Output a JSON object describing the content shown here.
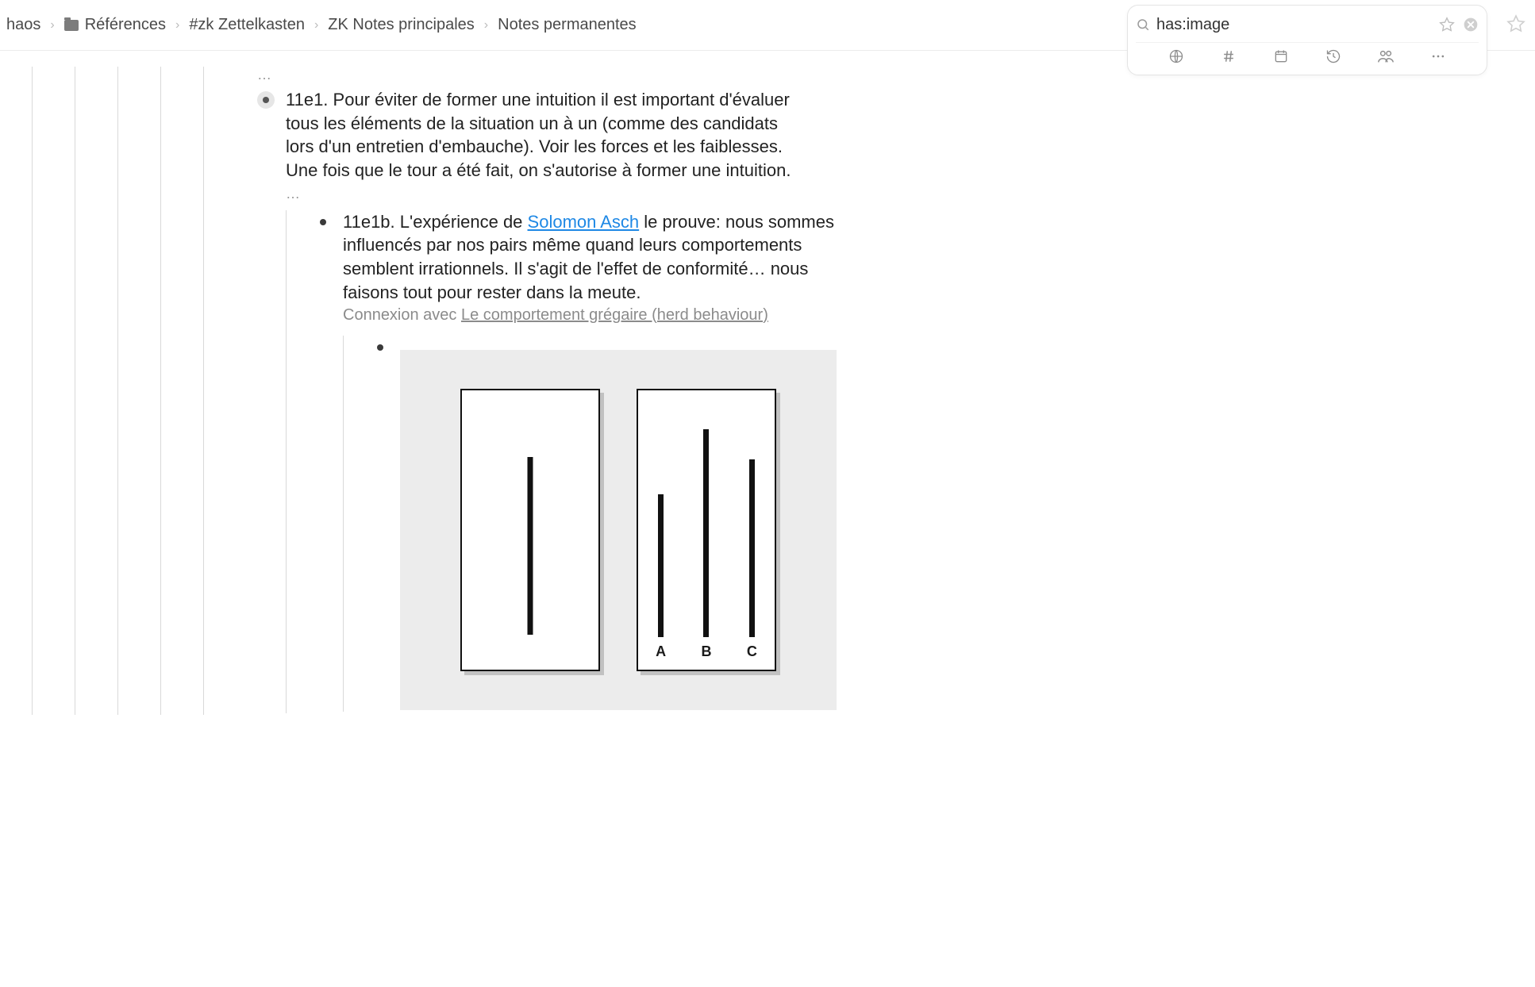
{
  "breadcrumb": {
    "items": [
      {
        "label": "haos",
        "icon": null
      },
      {
        "label": "Références",
        "icon": "folder"
      },
      {
        "label": "#zk Zettelkasten",
        "icon": null
      },
      {
        "label": "ZK Notes principales",
        "icon": null
      },
      {
        "label": "Notes permanentes",
        "icon": null
      }
    ]
  },
  "search": {
    "value": "has:image"
  },
  "outline": {
    "ellipsis": "…",
    "note11e1": "11e1. Pour éviter de former une intuition il est important d'évaluer tous les éléments de la situation un à un (comme des candidats lors d'un entretien d'embauche). Voir les forces et les faiblesses. Une fois que le tour a été fait, on s'autorise à former une intuition.",
    "note11e1_ellipsis": "…",
    "note11e1b_prefix": "11e1b. L'expérience de ",
    "note11e1b_link": "Solomon Asch",
    "note11e1b_suffix": " le prouve: nous sommes influencés par nos pairs même quand leurs comportements semblent irrationnels. Il s'agit de l'effet de conformité… nous faisons tout pour rester dans la meute.",
    "connection_prefix": "Connexion avec ",
    "connection_link": "Le comportement grégaire (herd behaviour)",
    "asch_labels": {
      "a": "A",
      "b": "B",
      "c": "C"
    }
  }
}
